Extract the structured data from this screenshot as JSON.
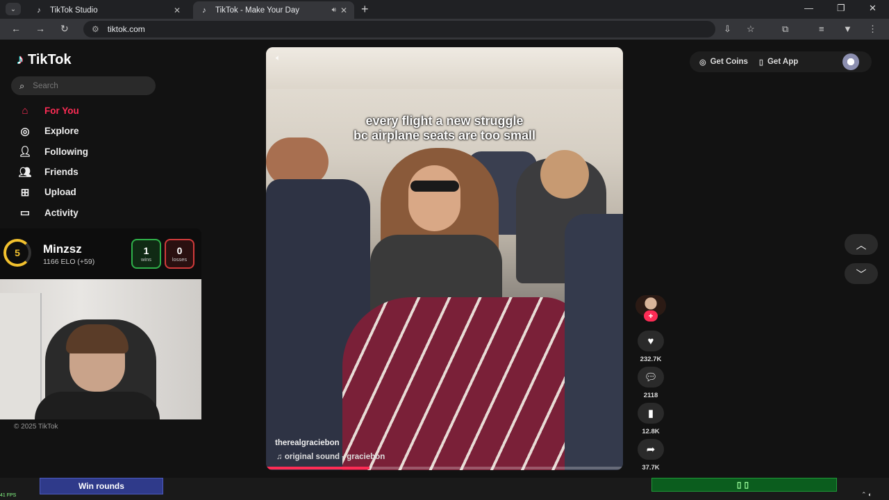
{
  "browser": {
    "tabs": [
      {
        "title": "TikTok Studio",
        "icon": "tiktok-icon"
      },
      {
        "title": "TikTok - Make Your Day",
        "icon": "tiktok-icon",
        "active": true
      }
    ],
    "url": "tiktok.com"
  },
  "sidebar": {
    "logo": "TikTok",
    "search_placeholder": "Search",
    "items": [
      {
        "label": "For You",
        "icon": "home-icon",
        "active": true
      },
      {
        "label": "Explore",
        "icon": "compass-icon"
      },
      {
        "label": "Following",
        "icon": "following-icon"
      },
      {
        "label": "Friends",
        "icon": "friends-icon"
      },
      {
        "label": "Upload",
        "icon": "upload-icon"
      },
      {
        "label": "Activity",
        "icon": "activity-icon"
      }
    ],
    "copyright": "© 2025 TikTok"
  },
  "scorecard": {
    "rank": "5",
    "name": "Minzsz",
    "elo": "1166 ELO (+59)",
    "wins": "1",
    "wins_label": "wins",
    "losses": "0",
    "losses_label": "losses"
  },
  "video": {
    "caption_line1": "every flight a new struggle",
    "caption_line2": "bc airplane seats are too small",
    "username": "therealgraciebon",
    "sound": "original sound - graciebon",
    "progress_fraction": 0.29
  },
  "actions": {
    "likes": "232.7K",
    "comments": "2118",
    "saves": "12.8K",
    "shares": "37.7K"
  },
  "topright": {
    "coins": "Get Coins",
    "app": "Get App"
  },
  "overlay_bottom": {
    "button": "Win rounds",
    "fps": "41 FPS"
  },
  "colors": {
    "accent": "#fe2c55",
    "bg": "#121212"
  }
}
